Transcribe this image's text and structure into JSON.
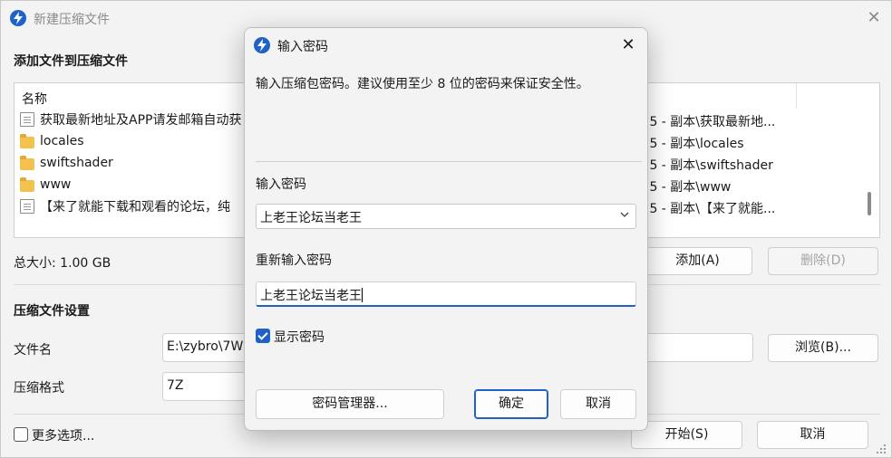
{
  "main": {
    "title": "新建压缩文件",
    "add_files_heading": "添加文件到压缩文件",
    "list": {
      "name_header": "名称",
      "rows": [
        {
          "name": "获取最新地址及APP请发邮箱自动获",
          "type": "doc",
          "path": ".5 - 副本\\获取最新地..."
        },
        {
          "name": "locales",
          "type": "folder",
          "path": ".5 - 副本\\locales"
        },
        {
          "name": "swiftshader",
          "type": "folder",
          "path": ".5 - 副本\\swiftshader"
        },
        {
          "name": "www",
          "type": "folder",
          "path": ".5 - 副本\\www"
        },
        {
          "name": "【来了就能下载和观看的论坛，纯",
          "type": "doc",
          "path": ".5 - 副本\\【来了就能..."
        }
      ]
    },
    "total_size": "总大小: 1.00 GB",
    "add_button": "添加(A)",
    "delete_button": "删除(D)",
    "settings_heading": "压缩文件设置",
    "filename_label": "文件名",
    "filename_value": "E:\\zybro\\7W",
    "browse_button": "浏览(B)...",
    "format_label": "压缩格式",
    "format_value": "7Z",
    "more_options_label": "更多选项...",
    "start_button": "开始(S)",
    "cancel_button": "取消"
  },
  "dialog": {
    "title": "输入密码",
    "description": "输入压缩包密码。建议使用至少 8 位的密码来保证安全性。",
    "password_label": "输入密码",
    "password_value": "上老王论坛当老王",
    "reenter_label": "重新输入密码",
    "reenter_value": "上老王论坛当老王",
    "show_password_label": "显示密码",
    "show_password_checked": true,
    "manager_button": "密码管理器...",
    "ok_button": "确定",
    "cancel_button": "取消"
  },
  "colors": {
    "accent": "#1f62c7",
    "folder": "#f2c14e"
  }
}
